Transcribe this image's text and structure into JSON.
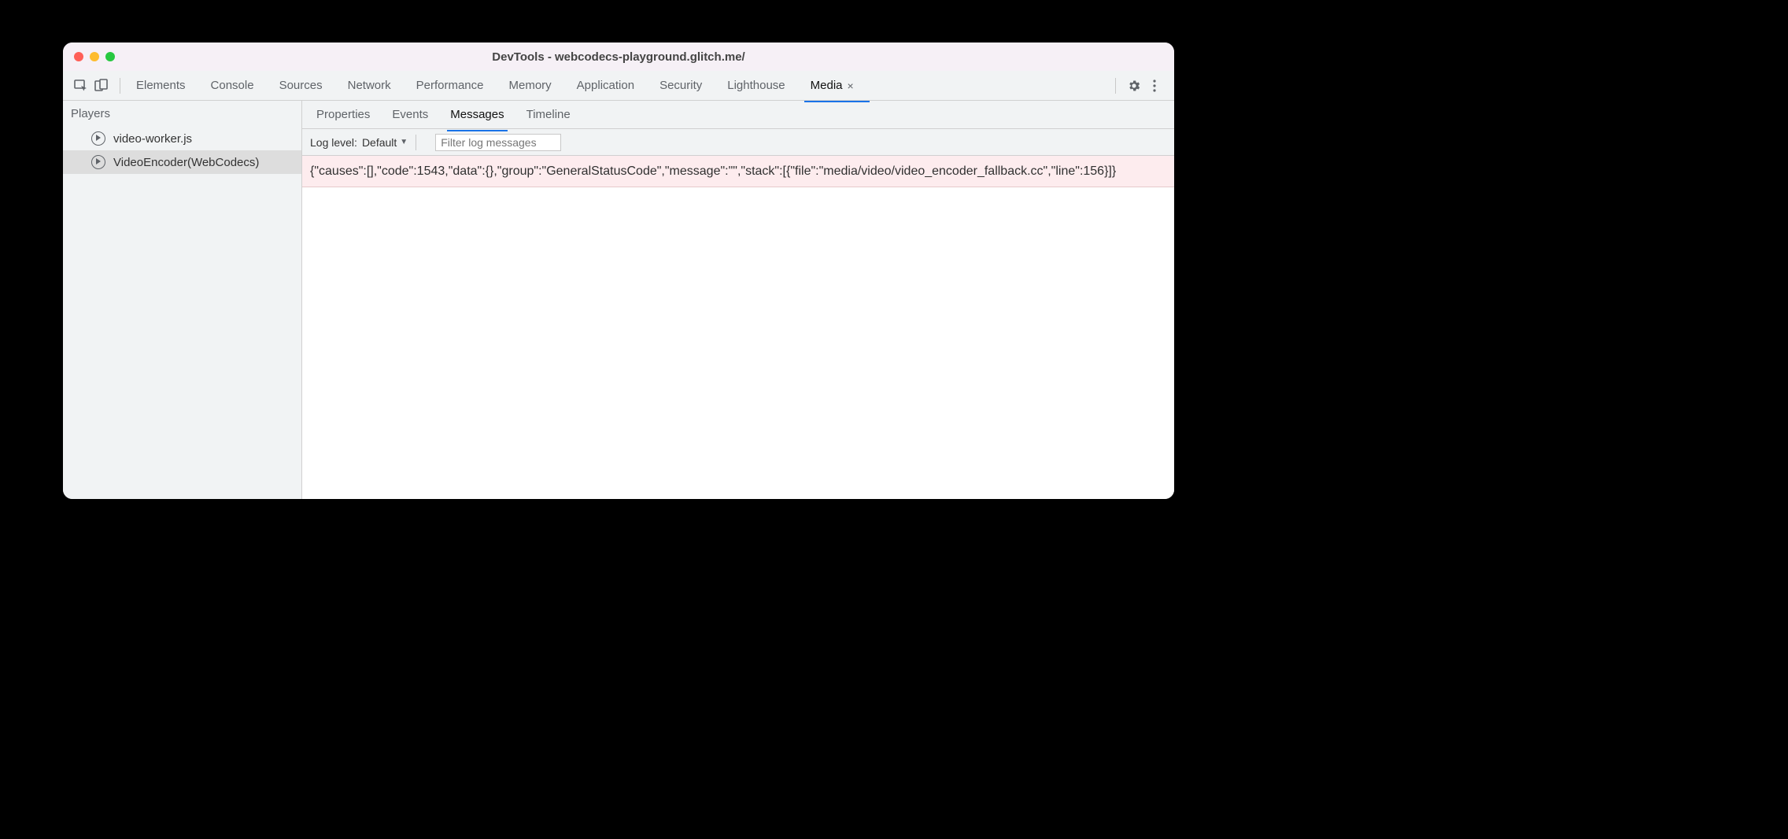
{
  "window": {
    "title": "DevTools - webcodecs-playground.glitch.me/"
  },
  "tabs": {
    "items": [
      "Elements",
      "Console",
      "Sources",
      "Network",
      "Performance",
      "Memory",
      "Application",
      "Security",
      "Lighthouse",
      "Media"
    ],
    "active": "Media"
  },
  "sidebar": {
    "heading": "Players",
    "items": [
      {
        "label": "video-worker.js"
      },
      {
        "label": "VideoEncoder(WebCodecs)"
      }
    ],
    "selected": 1
  },
  "subtabs": {
    "items": [
      "Properties",
      "Events",
      "Messages",
      "Timeline"
    ],
    "active": "Messages"
  },
  "filterbar": {
    "loglevel_label": "Log level:",
    "loglevel_value": "Default",
    "filter_placeholder": "Filter log messages"
  },
  "log": {
    "rows": [
      "{\"causes\":[],\"code\":1543,\"data\":{},\"group\":\"GeneralStatusCode\",\"message\":\"\",\"stack\":[{\"file\":\"media/video/video_encoder_fallback.cc\",\"line\":156}]}"
    ]
  }
}
